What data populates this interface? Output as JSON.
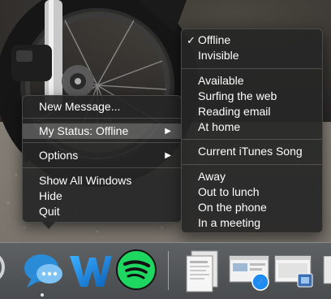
{
  "dock_context_menu": {
    "items": [
      {
        "label": "New Message..."
      },
      {
        "label": "My Status: Offline",
        "submenu_arrow": "▶"
      },
      {
        "label": "Options",
        "submenu_arrow": "▶"
      },
      {
        "label": "Show All Windows"
      },
      {
        "label": "Hide"
      },
      {
        "label": "Quit"
      }
    ]
  },
  "status_submenu": {
    "checkmark": "✓",
    "items": [
      {
        "label": "Offline",
        "checked": true
      },
      {
        "label": "Invisible"
      },
      {
        "label": "Available"
      },
      {
        "label": "Surfing the web"
      },
      {
        "label": "Reading email"
      },
      {
        "label": "At home"
      },
      {
        "label": "Current iTunes Song"
      },
      {
        "label": "Away"
      },
      {
        "label": "Out to lunch"
      },
      {
        "label": "On the phone"
      },
      {
        "label": "In a meeting"
      }
    ]
  },
  "dock": {
    "apps": [
      {
        "icon": "messages-icon",
        "running": true
      },
      {
        "icon": "word-w-icon"
      },
      {
        "icon": "spotify-icon"
      },
      {
        "icon": "document-preview-icon"
      },
      {
        "icon": "safari-window-preview-icon"
      },
      {
        "icon": "preview-window-icon"
      }
    ]
  },
  "colors": {
    "menu_bg": "#262626",
    "highlight": "#5a5a5a",
    "spotify_green": "#1ed760",
    "messages_blue": "#2a8cd6"
  }
}
